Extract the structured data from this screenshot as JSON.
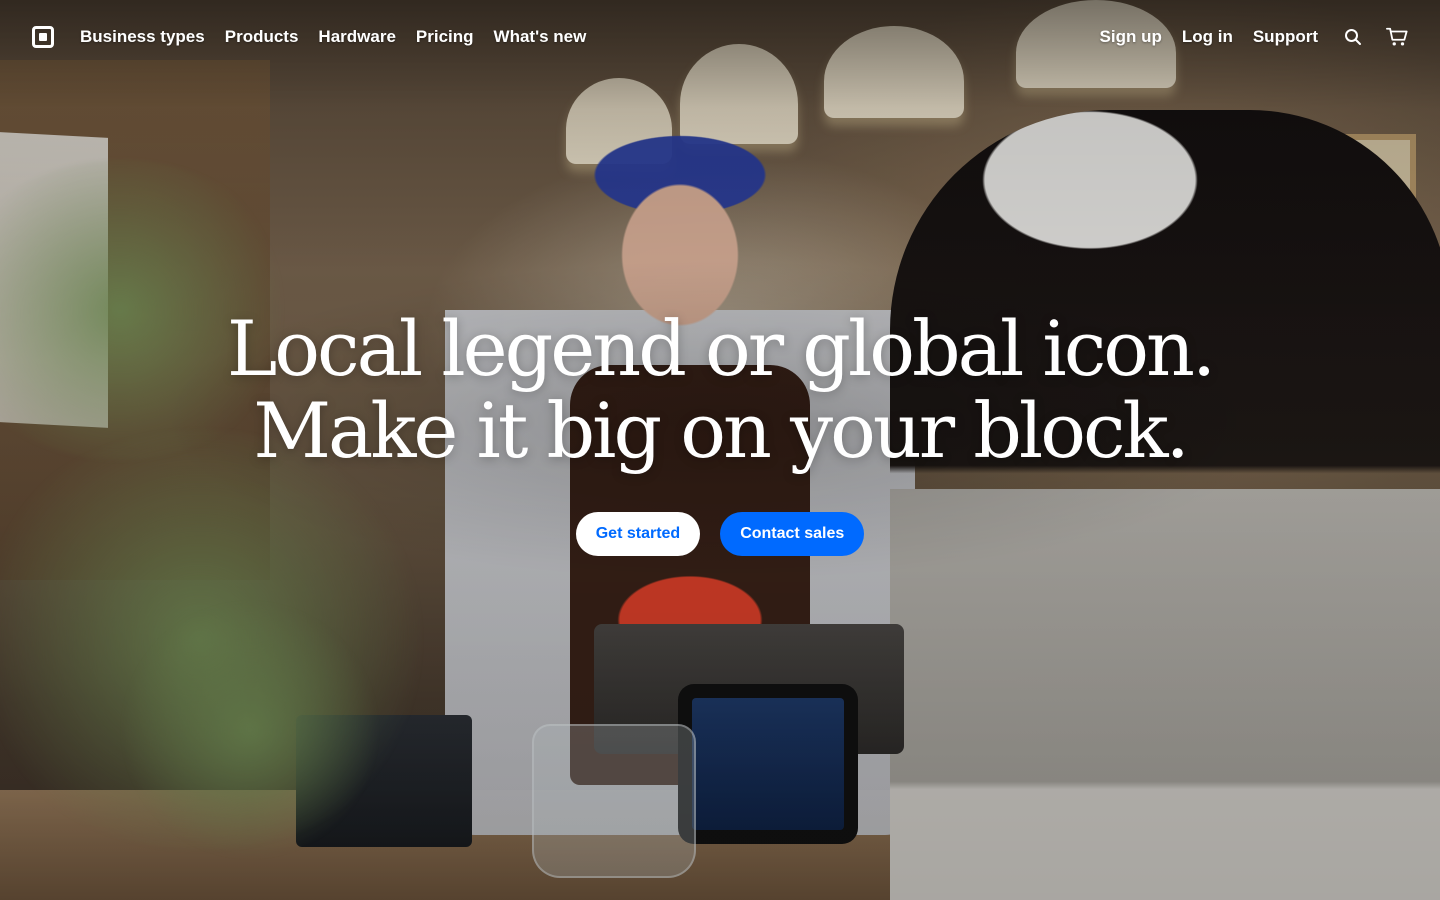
{
  "nav": {
    "left_items": [
      {
        "label": "Business types"
      },
      {
        "label": "Products"
      },
      {
        "label": "Hardware"
      },
      {
        "label": "Pricing"
      },
      {
        "label": "What's new"
      }
    ],
    "right_items": [
      {
        "label": "Sign up"
      },
      {
        "label": "Log in"
      },
      {
        "label": "Support"
      }
    ],
    "icons": {
      "logo": "square-logo-icon",
      "search": "search-icon",
      "cart": "cart-icon"
    }
  },
  "hero": {
    "headline_line1": "Local legend or global icon.",
    "headline_line2": "Make it big on your block.",
    "buttons": {
      "get_started": "Get started",
      "contact_sales": "Contact sales"
    }
  },
  "colors": {
    "accent": "#006aff",
    "text": "#ffffff"
  }
}
